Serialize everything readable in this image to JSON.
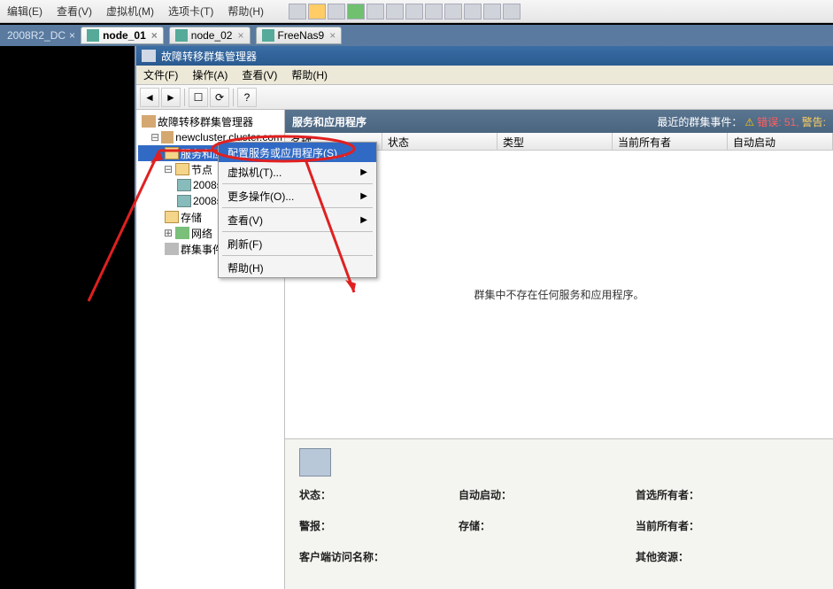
{
  "host_menu": {
    "items": [
      "编辑(E)",
      "查看(V)",
      "虚拟机(M)",
      "选项卡(T)",
      "帮助(H)"
    ]
  },
  "tabs": {
    "left_crumb": "2008R2_DC",
    "items": [
      {
        "label": "node_01",
        "active": true
      },
      {
        "label": "node_02",
        "active": false
      },
      {
        "label": "FreeNas9",
        "active": false
      }
    ]
  },
  "mmc": {
    "title": "故障转移群集管理器",
    "menu": [
      "文件(F)",
      "操作(A)",
      "查看(V)",
      "帮助(H)"
    ]
  },
  "tree": {
    "root": "故障转移群集管理器",
    "cluster": "newcluster.cluster.com",
    "selected": "服务和应用程序",
    "nodes": "节点",
    "node_items": [
      "2008se",
      "2008se"
    ],
    "storage": "存储",
    "network": "网络",
    "events": "群集事件"
  },
  "content": {
    "header": "服务和应用程序",
    "recent_label": "最近的群集事件：",
    "recent_err": "错误: 51,",
    "recent_warn": "警告:",
    "columns": [
      "名称",
      "状态",
      "类型",
      "当前所有者",
      "自动启动"
    ],
    "empty_msg": "群集中不存在任何服务和应用程序。"
  },
  "details": {
    "rows": [
      [
        "状态：",
        "自动启动：",
        "首选所有者："
      ],
      [
        "警报：",
        "存储：",
        "当前所有者："
      ],
      [
        "客户端访问名称：",
        "",
        "其他资源："
      ]
    ]
  },
  "context_menu": {
    "items": [
      {
        "label": "配置服务或应用程序(S)...",
        "arrow": false,
        "hl": true
      },
      {
        "label": "虚拟机(T)...",
        "arrow": true
      },
      {
        "label": "更多操作(O)...",
        "arrow": true
      },
      {
        "label": "查看(V)",
        "arrow": true
      },
      {
        "label": "刷新(F)",
        "arrow": false
      },
      {
        "label": "帮助(H)",
        "arrow": false
      }
    ]
  }
}
